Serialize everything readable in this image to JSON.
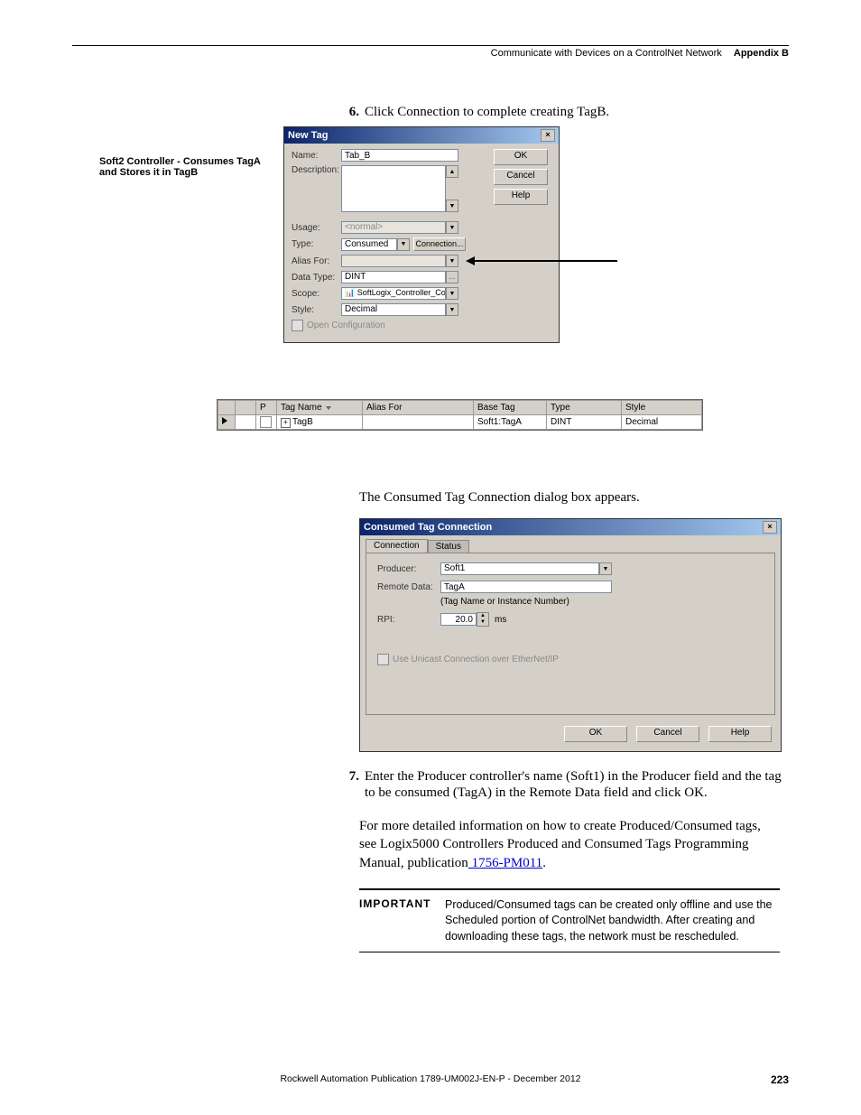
{
  "header": {
    "chapter": "Communicate with Devices on a ControlNet Network",
    "appendix": "Appendix B"
  },
  "side_note": "Soft2 Controller - Consumes TagA and Stores it in TagB",
  "step6": {
    "num": "6.",
    "text": "Click Connection to complete creating TagB."
  },
  "new_tag_dialog": {
    "title": "New Tag",
    "labels": {
      "name": "Name:",
      "description": "Description:",
      "usage": "Usage:",
      "type": "Type:",
      "alias_for": "Alias For:",
      "data_type": "Data Type:",
      "scope": "Scope:",
      "style": "Style:",
      "open_config": "Open Configuration"
    },
    "values": {
      "name": "Tab_B",
      "usage": "<normal>",
      "type": "Consumed",
      "connection_btn": "Connection...",
      "data_type": "DINT",
      "scope": "SoftLogix_Controller_ControlNe",
      "style": "Decimal"
    },
    "buttons": {
      "ok": "OK",
      "cancel": "Cancel",
      "help": "Help"
    }
  },
  "tag_table": {
    "headers": {
      "p": "P",
      "tag_name": "Tag Name",
      "alias_for": "Alias For",
      "base_tag": "Base Tag",
      "type": "Type",
      "style": "Style"
    },
    "row": {
      "tag_name": "TagB",
      "base_tag": "Soft1:TagA",
      "type": "DINT",
      "style": "Decimal"
    }
  },
  "para_after_dialog": "The Consumed Tag Connection dialog box appears.",
  "consumed_dialog": {
    "title": "Consumed Tag Connection",
    "tabs": {
      "connection": "Connection",
      "status": "Status"
    },
    "labels": {
      "producer": "Producer:",
      "remote_data": "Remote Data:",
      "hint": "(Tag Name or Instance Number)",
      "rpi": "RPI:",
      "ms": "ms",
      "unicast": "Use Unicast Connection over EtherNet/IP"
    },
    "values": {
      "producer": "Soft1",
      "remote_data": "TagA",
      "rpi": "20.0"
    },
    "buttons": {
      "ok": "OK",
      "cancel": "Cancel",
      "help": "Help"
    }
  },
  "step7": {
    "num": "7.",
    "text": "Enter the Producer controller's name (Soft1) in the Producer field and the tag to be consumed (TagA) in the Remote Data field and click OK."
  },
  "detail_para": {
    "line1": "For more detailed information on how to create Produced/Consumed tags, see Logix5000 Controllers Produced and Consumed Tags Programming Manual, publication",
    "link": " 1756-PM011",
    "period": "."
  },
  "important": {
    "label": "IMPORTANT",
    "text": "Produced/Consumed tags can be created only offline and use the Scheduled portion of ControlNet bandwidth. After creating and downloading these tags, the network must be rescheduled."
  },
  "footer": {
    "text": "Rockwell Automation Publication 1789-UM002J-EN-P - December 2012",
    "page": "223"
  }
}
